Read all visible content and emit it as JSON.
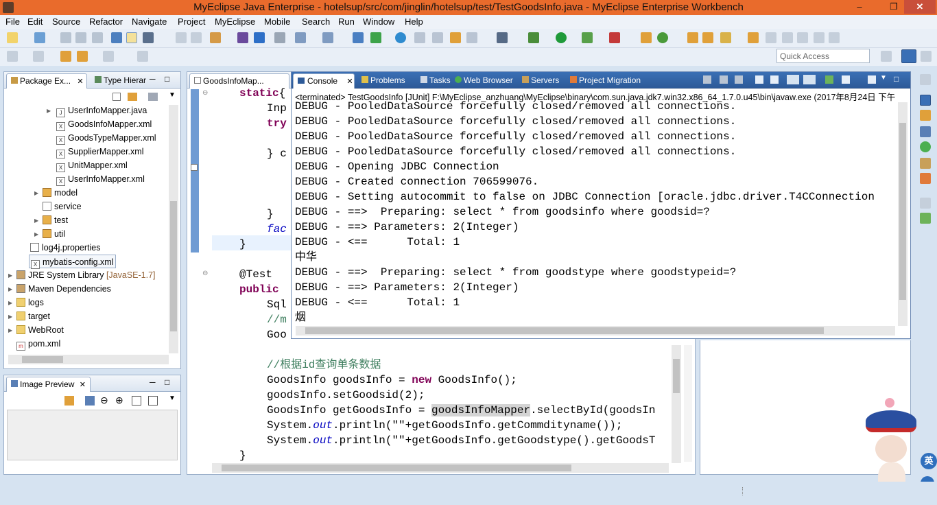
{
  "window": {
    "title": "MyEclipse Java Enterprise - hotelsup/src/com/jinglin/hotelsup/test/TestGoodsInfo.java - MyEclipse Enterprise Workbench"
  },
  "menu": [
    "File",
    "Edit",
    "Source",
    "Refactor",
    "Navigate",
    "Project",
    "MyEclipse",
    "Mobile",
    "Search",
    "Run",
    "Window",
    "Help"
  ],
  "quick_access": {
    "placeholder": "Quick Access"
  },
  "package_explorer": {
    "tabs": [
      "Package Ex...",
      "Type Hierar"
    ],
    "items": [
      "UserInfoMapper.java",
      "GoodsInfoMapper.xml",
      "GoodsTypeMapper.xml",
      "SupplierMapper.xml",
      "UnitMapper.xml",
      "UserInfoMapper.xml",
      "model",
      "service",
      "test",
      "util",
      "log4j.properties",
      "mybatis-config.xml",
      "JRE System Library",
      "Maven Dependencies",
      "logs",
      "target",
      "WebRoot",
      "pom.xml"
    ],
    "jre_version": "[JavaSE-1.7]"
  },
  "image_preview": {
    "tab": "Image Preview"
  },
  "editor": {
    "tab": "GoodsInfoMap...",
    "lines": [
      {
        "parts": [
          {
            "t": "static",
            "c": "kw"
          },
          {
            "t": "{",
            "c": ""
          }
        ]
      },
      {
        "parts": [
          {
            "t": "Inp",
            "c": ""
          }
        ]
      },
      {
        "parts": [
          {
            "t": "try",
            "c": "kw"
          }
        ]
      },
      {
        "parts": [
          {
            "t": "",
            "c": ""
          }
        ]
      },
      {
        "parts": [
          {
            "t": "} c",
            "c": ""
          }
        ]
      },
      {
        "parts": [
          {
            "t": "",
            "c": ""
          }
        ]
      },
      {
        "parts": [
          {
            "t": "",
            "c": ""
          }
        ]
      },
      {
        "parts": [
          {
            "t": "",
            "c": ""
          }
        ]
      },
      {
        "parts": [
          {
            "t": "}",
            "c": ""
          }
        ]
      },
      {
        "parts": [
          {
            "t": "fac",
            "c": "it"
          }
        ]
      },
      {
        "parts": [
          {
            "t": "}",
            "c": ""
          }
        ]
      },
      {
        "parts": [
          {
            "t": "",
            "c": ""
          }
        ]
      },
      {
        "parts": [
          {
            "t": "@Test",
            "c": ""
          }
        ]
      },
      {
        "parts": [
          {
            "t": "public",
            "c": "kw"
          }
        ]
      },
      {
        "parts": [
          {
            "t": "Sql",
            "c": ""
          }
        ]
      },
      {
        "parts": [
          {
            "t": "//m",
            "c": "cm"
          }
        ]
      },
      {
        "parts": [
          {
            "t": "Goo",
            "c": ""
          }
        ]
      },
      {
        "parts": [
          {
            "t": "",
            "c": ""
          }
        ]
      },
      {
        "parts": [
          {
            "t": "//根据id查询单条数据",
            "c": "cm"
          }
        ]
      },
      {
        "parts": [
          {
            "t": "GoodsInfo goodsInfo = ",
            "c": ""
          },
          {
            "t": "new",
            "c": "kw"
          },
          {
            "t": " GoodsInfo();",
            "c": ""
          }
        ]
      },
      {
        "parts": [
          {
            "t": "goodsInfo.setGoodsid(2);",
            "c": ""
          }
        ]
      },
      {
        "parts": [
          {
            "t": "GoodsInfo getGoodsInfo = ",
            "c": ""
          },
          {
            "t": "goodsInfoMapper",
            "c": "hl"
          },
          {
            "t": ".selectById(goodsIn",
            "c": ""
          }
        ]
      },
      {
        "parts": [
          {
            "t": "System.",
            "c": ""
          },
          {
            "t": "out",
            "c": "it"
          },
          {
            "t": ".println(\"\"+getGoodsInfo.getCommdityname());",
            "c": ""
          }
        ]
      },
      {
        "parts": [
          {
            "t": "System.",
            "c": ""
          },
          {
            "t": "out",
            "c": "it"
          },
          {
            "t": ".println(\"\"+getGoodsInfo.getGoodstype().getGoodsT",
            "c": ""
          }
        ]
      },
      {
        "parts": [
          {
            "t": "}",
            "c": ""
          }
        ]
      }
    ]
  },
  "console": {
    "tabs": [
      "Console",
      "Problems",
      "Tasks",
      "Web Browser",
      "Servers",
      "Project Migration"
    ],
    "header": "<terminated> TestGoodsInfo [JUnit] F:\\MyEclipse_anzhuang\\MyEclipse\\binary\\com.sun.java.jdk7.win32.x86_64_1.7.0.u45\\bin\\javaw.exe (2017年8月24日 下午",
    "lines": [
      "DEBUG - PooledDataSource forcefully closed/removed all connections.",
      "DEBUG - PooledDataSource forcefully closed/removed all connections.",
      "DEBUG - PooledDataSource forcefully closed/removed all connections.",
      "DEBUG - PooledDataSource forcefully closed/removed all connections.",
      "DEBUG - Opening JDBC Connection",
      "DEBUG - Created connection 706599076.",
      "DEBUG - Setting autocommit to false on JDBC Connection [oracle.jdbc.driver.T4CConnection",
      "DEBUG - ==>  Preparing: select * from goodsinfo where goodsid=?",
      "DEBUG - ==> Parameters: 2(Integer)",
      "DEBUG - <==      Total: 1",
      "中华",
      "DEBUG - ==>  Preparing: select * from goodstype where goodstypeid=?",
      "DEBUG - ==> Parameters: 2(Integer)",
      "DEBUG - <==      Total: 1",
      "烟"
    ]
  },
  "ime": {
    "label": "英"
  },
  "colors": {
    "title_bar": "#e96b2c",
    "keyword": "#7f0055",
    "comment": "#3f7f5f",
    "field": "#0000c0"
  }
}
